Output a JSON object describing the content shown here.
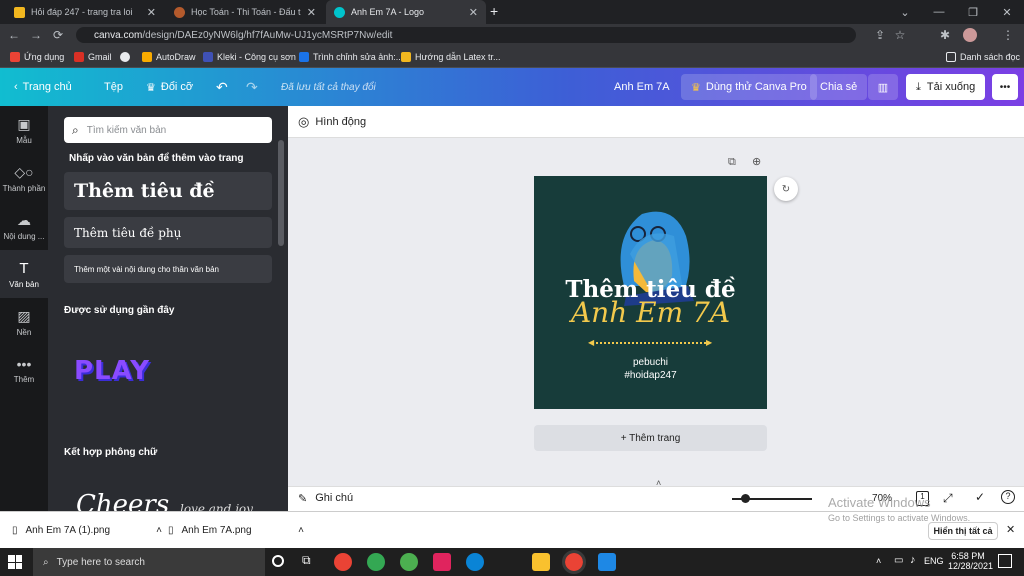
{
  "browser": {
    "tabs": [
      {
        "title": "Hỏi đáp 247 - trang tra loi"
      },
      {
        "title": "Học Toán - Thi Toán - Đấu trường"
      },
      {
        "title": "Anh Em 7A - Logo"
      }
    ],
    "url_host": "canva.com",
    "url_path": "/design/DAEz0yNW6lg/hf7fAuMw-UJ1ycMSRtP7Nw/edit",
    "bookmarks": [
      "Ứng dụng",
      "Gmail",
      "AutoDraw",
      "Kleki - Công cụ sơn",
      "Trình chỉnh sửa ảnh:...",
      "Hướng dẫn Latex tr..."
    ],
    "reading_list": "Danh sách đọc"
  },
  "header": {
    "home": "Trang chủ",
    "file": "Tệp",
    "resize": "Đổi cỡ",
    "saved": "Đã lưu tất cả thay đổi",
    "doc_title": "Anh Em 7A",
    "try_pro": "Dùng thử Canva Pro",
    "share": "Chia sẻ",
    "download": "Tải xuống",
    "more": "•••"
  },
  "rail": [
    {
      "label": "Mẫu"
    },
    {
      "label": "Thành phần"
    },
    {
      "label": "Nội dung ..."
    },
    {
      "label": "Văn bản"
    },
    {
      "label": "Nền"
    },
    {
      "label": "Thêm"
    }
  ],
  "panel": {
    "search_placeholder": "Tìm kiếm văn bản",
    "heading": "Nhấp vào văn bản để thêm vào trang",
    "add_title": "Thêm tiêu đề",
    "add_subtitle": "Thêm tiêu đề phụ",
    "add_body": "Thêm một vài nội dung cho thân văn bản",
    "recent": "Được sử dụng gần đây",
    "recent_sample": "PLAY",
    "combos": "Kết hợp phông chữ",
    "combo_sample1": "Cheers",
    "combo_sample2": "love and joy"
  },
  "editor": {
    "animate": "Hình động",
    "design_title": "Thêm tiêu đề",
    "design_script": "Anh Em 7A",
    "design_line1": "pebuchi",
    "design_line2": "#hoidap247",
    "add_page": "+ Thêm trang",
    "notes": "Ghi chú",
    "zoom": "70%",
    "page_num": "1",
    "activate1": "Activate Windows",
    "activate2": "Go to Settings to activate Windows."
  },
  "downloads": {
    "items": [
      "Anh Em 7A (1).png",
      "Anh Em 7A.png"
    ],
    "show_all": "Hiển thị tất cả"
  },
  "taskbar": {
    "search_placeholder": "Type here to search",
    "lang": "ENG",
    "time": "6:58 PM",
    "date": "12/28/2021"
  },
  "colors": {
    "accent": "#7b3fe4",
    "design_bg": "#173c3a",
    "gold": "#f2c94c"
  }
}
